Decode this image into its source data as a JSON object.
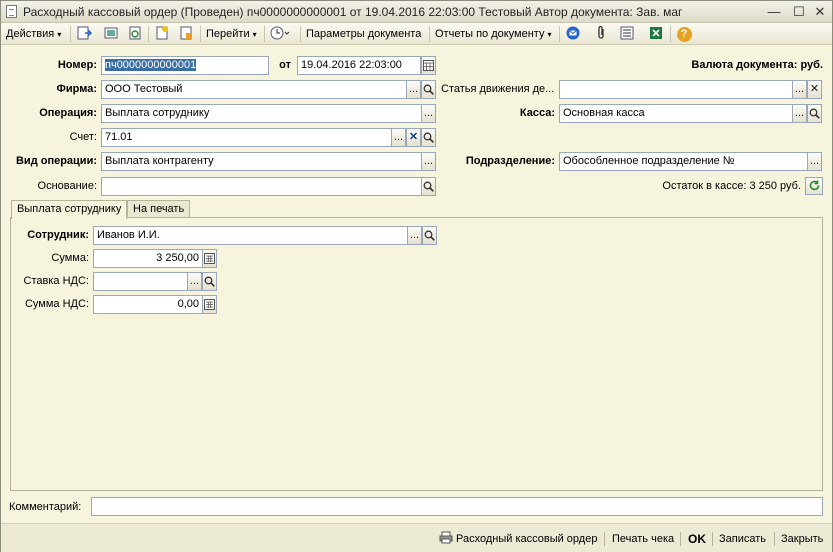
{
  "window": {
    "title": "Расходный кассовый ордер (Проведен)  пч0000000000001 от 19.04.2016 22:03:00 Тестовый Автор документа: Зав. маг",
    "min_symbol": "—",
    "max_symbol": "☐",
    "close_symbol": "✕"
  },
  "toolbar": {
    "actions_label": "Действия",
    "goto_label": "Перейти",
    "params_label": "Параметры документа",
    "reports_label": "Отчеты по документу",
    "dropdown_arrow": "▾",
    "help_symbol": "?"
  },
  "form": {
    "number_label": "Номер:",
    "number_value": "пч0000000000001",
    "date_label": "от",
    "date_value": "19.04.2016 22:03:00",
    "currency_text": "Валюта документа: руб.",
    "firm_label": "Фирма:",
    "firm_value": "ООО Тестовый",
    "article_label": "Статья движения де...",
    "article_value": "",
    "operation_label": "Операция:",
    "operation_value": "Выплата сотруднику",
    "kassa_label": "Касса:",
    "kassa_value": "Основная касса",
    "account_label": "Счет:",
    "account_value": "71.01",
    "op_type_label": "Вид операции:",
    "op_type_value": "Выплата контрагенту",
    "division_label": "Подразделение:",
    "division_value": "Обособленное подразделение №",
    "basis_label": "Основание:",
    "basis_value": "",
    "balance_text": "Остаток в кассе: 3 250 руб."
  },
  "tabs": [
    {
      "label": "Выплата сотруднику",
      "active": true
    },
    {
      "label": "На печать",
      "active": false
    }
  ],
  "tab_content": {
    "employee_label": "Сотрудник:",
    "employee_value": "Иванов И.И.",
    "sum_label": "Сумма:",
    "sum_value": "3 250,00",
    "vat_rate_label": "Ставка НДС:",
    "vat_rate_value": "",
    "vat_sum_label": "Сумма НДС:",
    "vat_sum_value": "0,00"
  },
  "comment": {
    "label": "Комментарий:",
    "value": ""
  },
  "bottom": {
    "print_order_label": "Расходный кассовый ордер",
    "print_check_label": "Печать чека",
    "ok_label": "OK",
    "save_label": "Записать",
    "close_label": "Закрыть"
  },
  "common": {
    "dots": "...",
    "clear_symbol": "✕"
  }
}
